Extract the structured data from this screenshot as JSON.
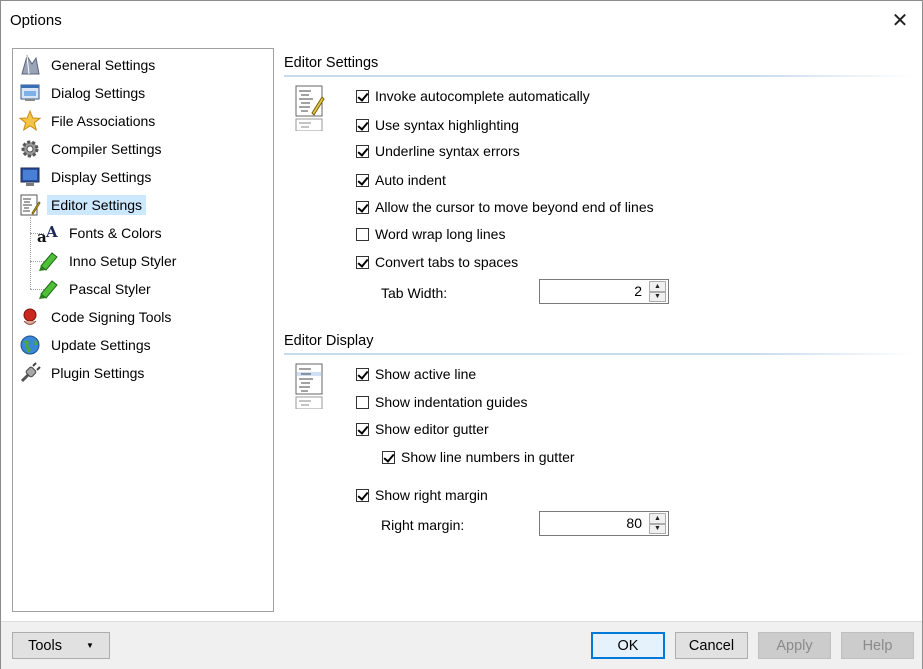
{
  "window": {
    "title": "Options"
  },
  "tree": {
    "items": [
      {
        "label": "General Settings"
      },
      {
        "label": "Dialog Settings"
      },
      {
        "label": "File Associations"
      },
      {
        "label": "Compiler Settings"
      },
      {
        "label": "Display Settings"
      },
      {
        "label": "Editor Settings"
      },
      {
        "label": "Fonts & Colors"
      },
      {
        "label": "Inno Setup Styler"
      },
      {
        "label": "Pascal Styler"
      },
      {
        "label": "Code Signing Tools"
      },
      {
        "label": "Update Settings"
      },
      {
        "label": "Plugin Settings"
      }
    ],
    "selected": "Editor Settings"
  },
  "editor_settings": {
    "title": "Editor Settings",
    "options": [
      {
        "label": "Invoke autocomplete automatically",
        "checked": true
      },
      {
        "label": "Use syntax highlighting",
        "checked": true
      },
      {
        "label": "Underline syntax errors",
        "checked": true
      },
      {
        "label": "Auto indent",
        "checked": true
      },
      {
        "label": "Allow the cursor to move beyond end of lines",
        "checked": true
      },
      {
        "label": "Word wrap long lines",
        "checked": false
      },
      {
        "label": "Convert tabs to spaces",
        "checked": true
      }
    ],
    "tab_width_label": "Tab Width:",
    "tab_width_value": "2"
  },
  "editor_display": {
    "title": "Editor Display",
    "options": [
      {
        "label": "Show active line",
        "checked": true
      },
      {
        "label": "Show indentation guides",
        "checked": false
      },
      {
        "label": "Show editor gutter",
        "checked": true
      },
      {
        "label": "Show line numbers in gutter",
        "checked": true
      },
      {
        "label": "Show right margin",
        "checked": true
      }
    ],
    "right_margin_label": "Right margin:",
    "right_margin_value": "80"
  },
  "footer": {
    "tools_label": "Tools",
    "ok_label": "OK",
    "cancel_label": "Cancel",
    "apply_label": "Apply",
    "help_label": "Help"
  },
  "colors": {
    "selection": "#cce8ff",
    "default_button_border": "#0078d7",
    "separator": "#c9dbef"
  }
}
